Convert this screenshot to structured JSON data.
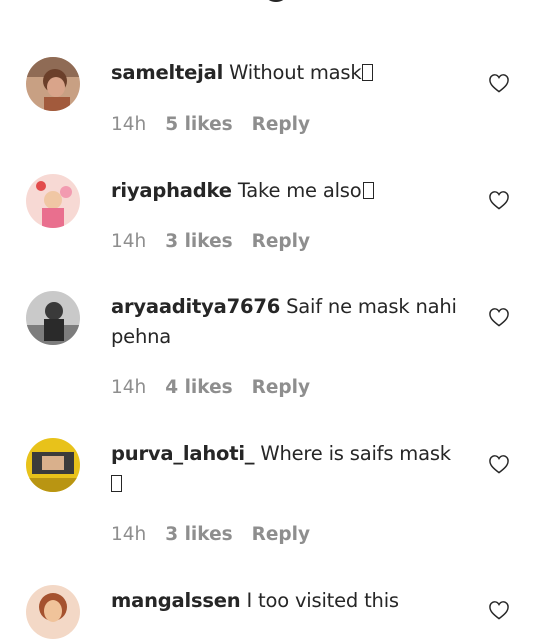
{
  "comments": [
    {
      "username": "sameltejal",
      "text": "Without mask",
      "continuation": "",
      "time": "14h",
      "likes": "5 likes",
      "reply": "Reply",
      "avatar_colors": [
        "#d9a48a",
        "#6b3f2a"
      ]
    },
    {
      "username": "riyaphadke",
      "text": "Take me also",
      "continuation": "",
      "time": "14h",
      "likes": "3 likes",
      "reply": "Reply",
      "avatar_colors": [
        "#f4c9c9",
        "#d95f6f"
      ]
    },
    {
      "username": "aryaaditya7676",
      "text": "Saif ne mask nahi",
      "continuation": "pehna",
      "time": "14h",
      "likes": "4 likes",
      "reply": "Reply",
      "avatar_colors": [
        "#9a9a9a",
        "#2a2a2a"
      ]
    },
    {
      "username": "purva_lahoti_",
      "text": "Where is saifs mask",
      "continuation": "",
      "time": "14h",
      "likes": "3 likes",
      "reply": "Reply",
      "avatar_colors": [
        "#e8c21a",
        "#3b3b3b"
      ]
    },
    {
      "username": "mangalssen",
      "text": "I too visited this",
      "continuation": "",
      "time": "",
      "likes": "",
      "reply": "",
      "avatar_colors": [
        "#f0c39a",
        "#a5522f"
      ]
    }
  ],
  "icons": {
    "like": "heart-outline-icon",
    "unsupported_char": "missing-glyph-box"
  },
  "colors": {
    "text": "#262626",
    "meta": "#8e8e8e"
  }
}
